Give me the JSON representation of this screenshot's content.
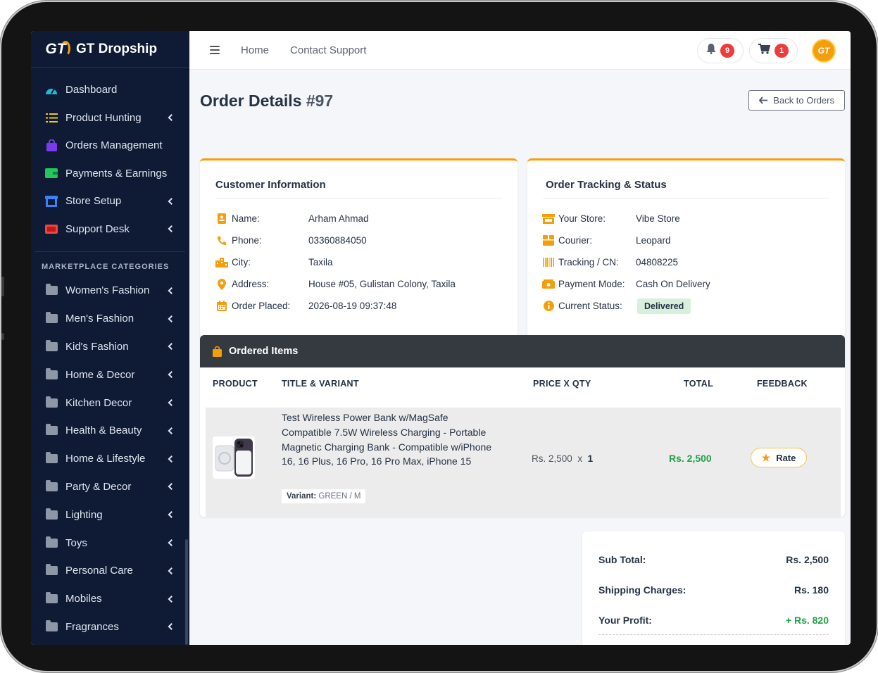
{
  "brand": {
    "name": "GT Dropship",
    "logo_text": "GT"
  },
  "sidebar": {
    "items": [
      {
        "label": "Dashboard",
        "icon": "dashboard-gauge-icon",
        "color": "#22b8cf",
        "has_submenu": false
      },
      {
        "label": "Product Hunting",
        "icon": "list-check-icon",
        "color": "#f5c518",
        "has_submenu": true
      },
      {
        "label": "Orders Management",
        "icon": "bag-icon",
        "color": "#7c3aed",
        "has_submenu": false
      },
      {
        "label": "Payments & Earnings",
        "icon": "wallet-icon",
        "color": "#22c55e",
        "has_submenu": false
      },
      {
        "label": "Store Setup",
        "icon": "store-icon",
        "color": "#3b82f6",
        "has_submenu": true
      },
      {
        "label": "Support Desk",
        "icon": "ticket-icon",
        "color": "#ef4444",
        "has_submenu": true
      }
    ],
    "section_header": "MARKETPLACE CATEGORIES",
    "categories": [
      "Women's Fashion",
      "Men's Fashion",
      "Kid's Fashion",
      "Home & Decor",
      "Kitchen Decor",
      "Health & Beauty",
      "Home & Lifestyle",
      "Party & Decor",
      "Lighting",
      "Toys",
      "Personal Care",
      "Mobiles",
      "Fragrances"
    ]
  },
  "topbar": {
    "links": [
      "Home",
      "Contact Support"
    ],
    "notifications_count": "9",
    "cart_count": "1",
    "avatar_text": "GT"
  },
  "page": {
    "title": "Order Details",
    "order_number": "#97",
    "back_label": "Back to Orders"
  },
  "customer": {
    "title": "Customer Information",
    "rows": [
      {
        "label": "Name:",
        "value": "Arham Ahmad",
        "icon": "id-badge-icon"
      },
      {
        "label": "Phone:",
        "value": "03360884050",
        "icon": "phone-icon"
      },
      {
        "label": "City:",
        "value": "Taxila",
        "icon": "city-icon"
      },
      {
        "label": "Address:",
        "value": "House #05, Gulistan Colony, Taxila",
        "icon": "map-pin-icon"
      },
      {
        "label": "Order Placed:",
        "value": "2026-08-19 09:37:48",
        "icon": "calendar-icon"
      }
    ]
  },
  "tracking": {
    "title": "Order Tracking & Status",
    "rows": [
      {
        "label": "Your Store:",
        "value": "Vibe Store",
        "icon": "store-icon"
      },
      {
        "label": "Courier:",
        "value": "Leopard",
        "icon": "box-icon"
      },
      {
        "label": "Tracking / CN:",
        "value": "04808225",
        "icon": "barcode-icon"
      },
      {
        "label": "Payment Mode:",
        "value": "Cash On Delivery",
        "icon": "cash-icon"
      }
    ],
    "status_label": "Current Status:",
    "status_value": "Delivered"
  },
  "items": {
    "title": "Ordered Items",
    "columns": [
      "PRODUCT",
      "TITLE & VARIANT",
      "PRICE X QTY",
      "TOTAL",
      "FEEDBACK"
    ],
    "rows": [
      {
        "title": "Test Wireless Power Bank w/MagSafe Compatible 7.5W Wireless Charging - Portable Magnetic Charging Bank - Compatible w/iPhone 16, 16 Plus, 16 Pro, 16 Pro Max, iPhone 15",
        "variant_label": "Variant:",
        "variant_value": "GREEN / M",
        "price": "Rs. 2,500",
        "x": "x",
        "qty": "1",
        "total": "Rs. 2,500",
        "feedback_label": "Rate"
      }
    ]
  },
  "summary": {
    "subtotal_label": "Sub Total:",
    "subtotal_value": "Rs. 2,500",
    "shipping_label": "Shipping Charges:",
    "shipping_value": "Rs. 180",
    "profit_label": "Your Profit:",
    "profit_value": "+ Rs. 820"
  },
  "colors": {
    "sidebar_bg": "#0f1b35",
    "accent": "#f59e0b",
    "success": "#22a045",
    "badge": "#ef3b3b"
  }
}
